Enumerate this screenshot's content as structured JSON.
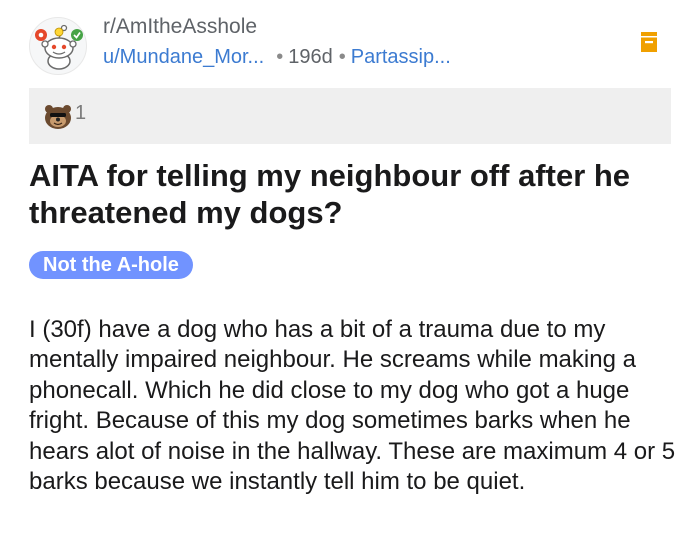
{
  "header": {
    "subreddit": "r/AmItheAsshole",
    "username": "u/Mundane_Mor...",
    "age": "196d",
    "extra": "Partassip...",
    "avatar_icon": "snoo-avatar-icon",
    "save_icon": "save-bookmark-icon"
  },
  "awards": {
    "icon": "award-icon",
    "count": "1"
  },
  "post": {
    "title": "AITA for telling my neighbour off after he threatened my dogs?",
    "flair": "Not the A-hole",
    "body": "I (30f) have a dog who has a bit of a trauma due to my mentally impaired neighbour. He screams while making a phonecall. Which he did close to my dog who got a huge fright. Because of this my dog sometimes barks when he hears alot of noise in the hallway. These are maximum 4 or 5 barks because we instantly tell him to be quiet."
  },
  "colors": {
    "link": "#3c7bd1",
    "flair_bg": "#7193ff",
    "save_icon": "#f0a000",
    "awards_bg": "#efefef"
  }
}
